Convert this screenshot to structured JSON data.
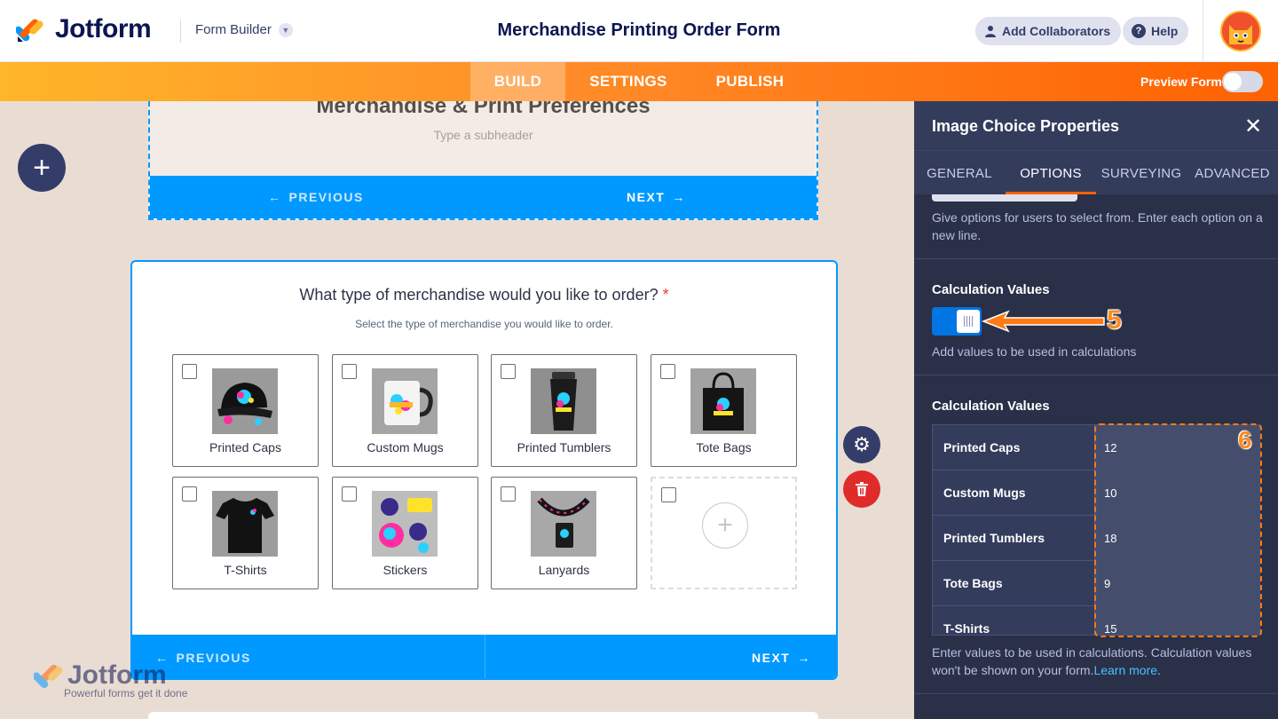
{
  "header": {
    "brand": "Jotform",
    "form_builder_label": "Form Builder",
    "form_title": "Merchandise Printing Order Form",
    "add_collaborators": "Add Collaborators",
    "help": "Help"
  },
  "nav": {
    "tabs": [
      "BUILD",
      "SETTINGS",
      "PUBLISH"
    ],
    "active_tab": "BUILD",
    "preview_label": "Preview Form",
    "preview_enabled": false
  },
  "canvas": {
    "page_header": {
      "title": "Merchandise & Print Preferences",
      "subheader_placeholder": "Type a subheader",
      "previous": "PREVIOUS",
      "next": "NEXT"
    },
    "question": {
      "title": "What type of merchandise would you like to order?",
      "required_mark": "*",
      "subtitle": "Select the type of merchandise you would like to order.",
      "options": [
        {
          "label": "Printed Caps",
          "image": "cap-image"
        },
        {
          "label": "Custom Mugs",
          "image": "mug-image"
        },
        {
          "label": "Printed Tumblers",
          "image": "tumbler-image"
        },
        {
          "label": "Tote Bags",
          "image": "tote-bag-image"
        },
        {
          "label": "T-Shirts",
          "image": "tshirt-image"
        },
        {
          "label": "Stickers",
          "image": "stickers-image"
        },
        {
          "label": "Lanyards",
          "image": "lanyard-image"
        }
      ],
      "previous": "PREVIOUS",
      "next": "NEXT"
    },
    "watermark": {
      "brand": "Jotform",
      "tagline": "Powerful forms get it done"
    }
  },
  "panel": {
    "title": "Image Choice Properties",
    "tabs": [
      "GENERAL",
      "OPTIONS",
      "SURVEYING",
      "ADVANCED"
    ],
    "active_tab": "OPTIONS",
    "options_hint": "Give options for users to select from. Enter each option on a new line.",
    "calc_toggle": {
      "title": "Calculation Values",
      "enabled": true,
      "hint": "Add values to be used in calculations"
    },
    "calc_values": {
      "title": "Calculation Values",
      "rows": [
        {
          "name": "Printed Caps",
          "value": "12"
        },
        {
          "name": "Custom Mugs",
          "value": "10"
        },
        {
          "name": "Printed Tumblers",
          "value": "18"
        },
        {
          "name": "Tote Bags",
          "value": "9"
        },
        {
          "name": "T-Shirts",
          "value": "15"
        }
      ],
      "hint": "Enter values to be used in calculations. Calculation values won't be shown on your form.",
      "learn_more": "Learn more"
    }
  },
  "annotations": {
    "step5": "5",
    "step6": "6",
    "color": "#ff7a14"
  },
  "colors": {
    "accent_blue": "#0099ff",
    "accent_orange": "#ff6100",
    "panel_bg": "#293048",
    "navy": "#0a1551"
  }
}
